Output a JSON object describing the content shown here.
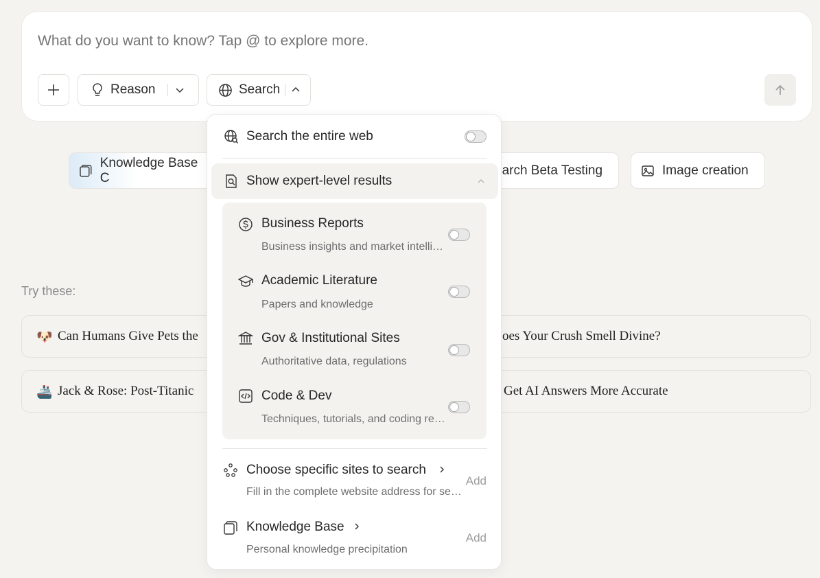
{
  "composer": {
    "placeholder": "What do you want to know? Tap @ to explore more.",
    "reason_label": "Reason",
    "search_label": "Search"
  },
  "chips": [
    {
      "label": "Knowledge Base C"
    },
    {
      "label": "earch Beta Testing"
    },
    {
      "label": "Image creation"
    }
  ],
  "try_label": "Try these:",
  "suggestions": [
    {
      "emoji": "🐶",
      "left": "Can Humans Give Pets the",
      "right": "oes Your Crush Smell Divine?"
    },
    {
      "emoji": "🚢",
      "left": "Jack & Rose: Post-Titanic",
      "right": "Get AI Answers More Accurate"
    }
  ],
  "dropdown": {
    "web": {
      "title": "Search the entire web"
    },
    "expert": {
      "title": "Show expert-level results",
      "items": [
        {
          "title": "Business Reports",
          "desc": "Business insights and market intelligence"
        },
        {
          "title": "Academic Literature",
          "desc": "Papers and knowledge"
        },
        {
          "title": "Gov & Institutional Sites",
          "desc": "Authoritative data, regulations"
        },
        {
          "title": "Code & Dev",
          "desc": "Techniques, tutorials, and coding resources"
        }
      ]
    },
    "sites": {
      "title": "Choose specific sites to search",
      "desc": "Fill in the complete website address for search",
      "action": "Add"
    },
    "kb": {
      "title": "Knowledge Base",
      "desc": "Personal knowledge precipitation",
      "action": "Add"
    }
  }
}
